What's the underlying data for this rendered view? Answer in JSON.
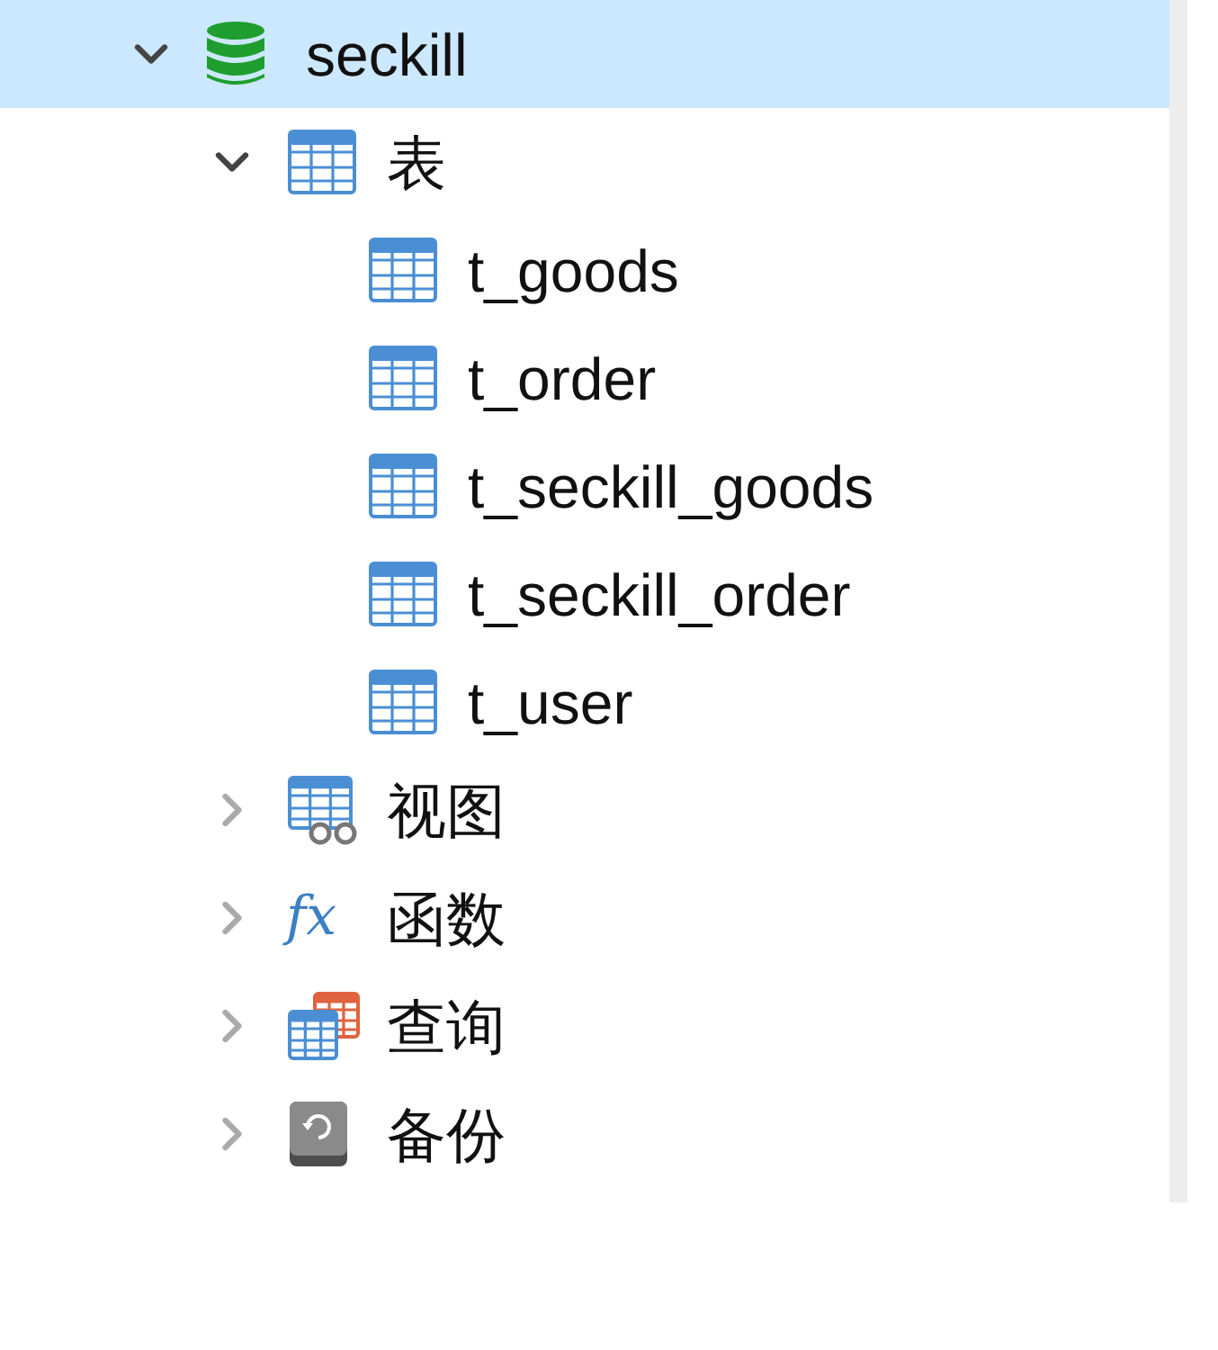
{
  "tree": [
    {
      "label": "seckill",
      "kind": "database",
      "expanded": true,
      "selected": true,
      "children": [
        {
          "label": "表",
          "kind": "tables",
          "expanded": true,
          "selected": false,
          "children": [
            {
              "label": "t_goods",
              "kind": "table",
              "selected": false
            },
            {
              "label": "t_order",
              "kind": "table",
              "selected": false
            },
            {
              "label": "t_seckill_goods",
              "kind": "table",
              "selected": false
            },
            {
              "label": "t_seckill_order",
              "kind": "table",
              "selected": false
            },
            {
              "label": "t_user",
              "kind": "table",
              "selected": false
            }
          ]
        },
        {
          "label": "视图",
          "kind": "views",
          "expanded": false,
          "selected": false
        },
        {
          "label": "函数",
          "kind": "functions",
          "icon_glyph": "fx",
          "expanded": false,
          "selected": false
        },
        {
          "label": "查询",
          "kind": "queries",
          "expanded": false,
          "selected": false
        },
        {
          "label": "备份",
          "kind": "backups",
          "expanded": false,
          "selected": false
        }
      ]
    }
  ]
}
